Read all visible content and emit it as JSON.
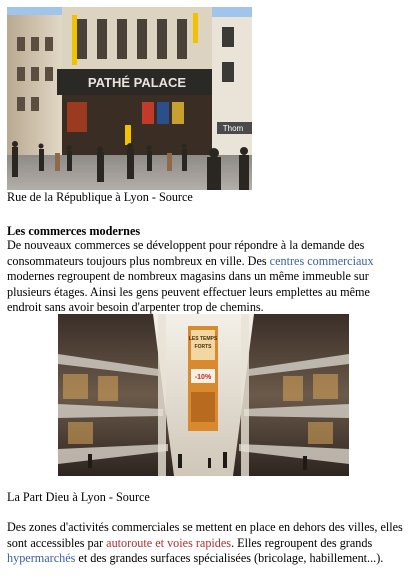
{
  "section1": {
    "caption": "Rue de la République à Lyon - Source"
  },
  "section2": {
    "heading": "Les commerces modernes",
    "para_before_link": "De nouveaux commerces se développent pour répondre à la demande des consommateurs toujours plus nombreux en ville. Des ",
    "link_text": "centres commerciaux",
    "para_after_link": " modernes regroupent de nombreux magasins dans un même immeuble sur plusieurs étages. Ainsi les gens peuvent effectuer leurs emplettes au même endroit sans avoir besoin d'arpenter trop de chemins.",
    "caption": "La Part Dieu à Lyon - Source"
  },
  "section3": {
    "para_before_link1": "Des zones d'activités commerciales se mettent en place en dehors des villes, elles sont accessibles par ",
    "link1_text": "autoroute et voies rapides",
    "para_between": ". Elles regroupent des grands ",
    "link2_text": "hypermarchés",
    "para_after": " et des grandes surfaces spécialisées (bricolage, habillement...)."
  },
  "photo1": {
    "sign_text": "PATHÉ PALACE",
    "shop_sign": "Thom"
  },
  "photo2": {
    "banner_line1": "LES TEMPS",
    "banner_line2": "FORTS",
    "banner_line3": "-10%"
  },
  "colors": {
    "link": "#3b5fa8",
    "link_alt": "#b03030"
  }
}
